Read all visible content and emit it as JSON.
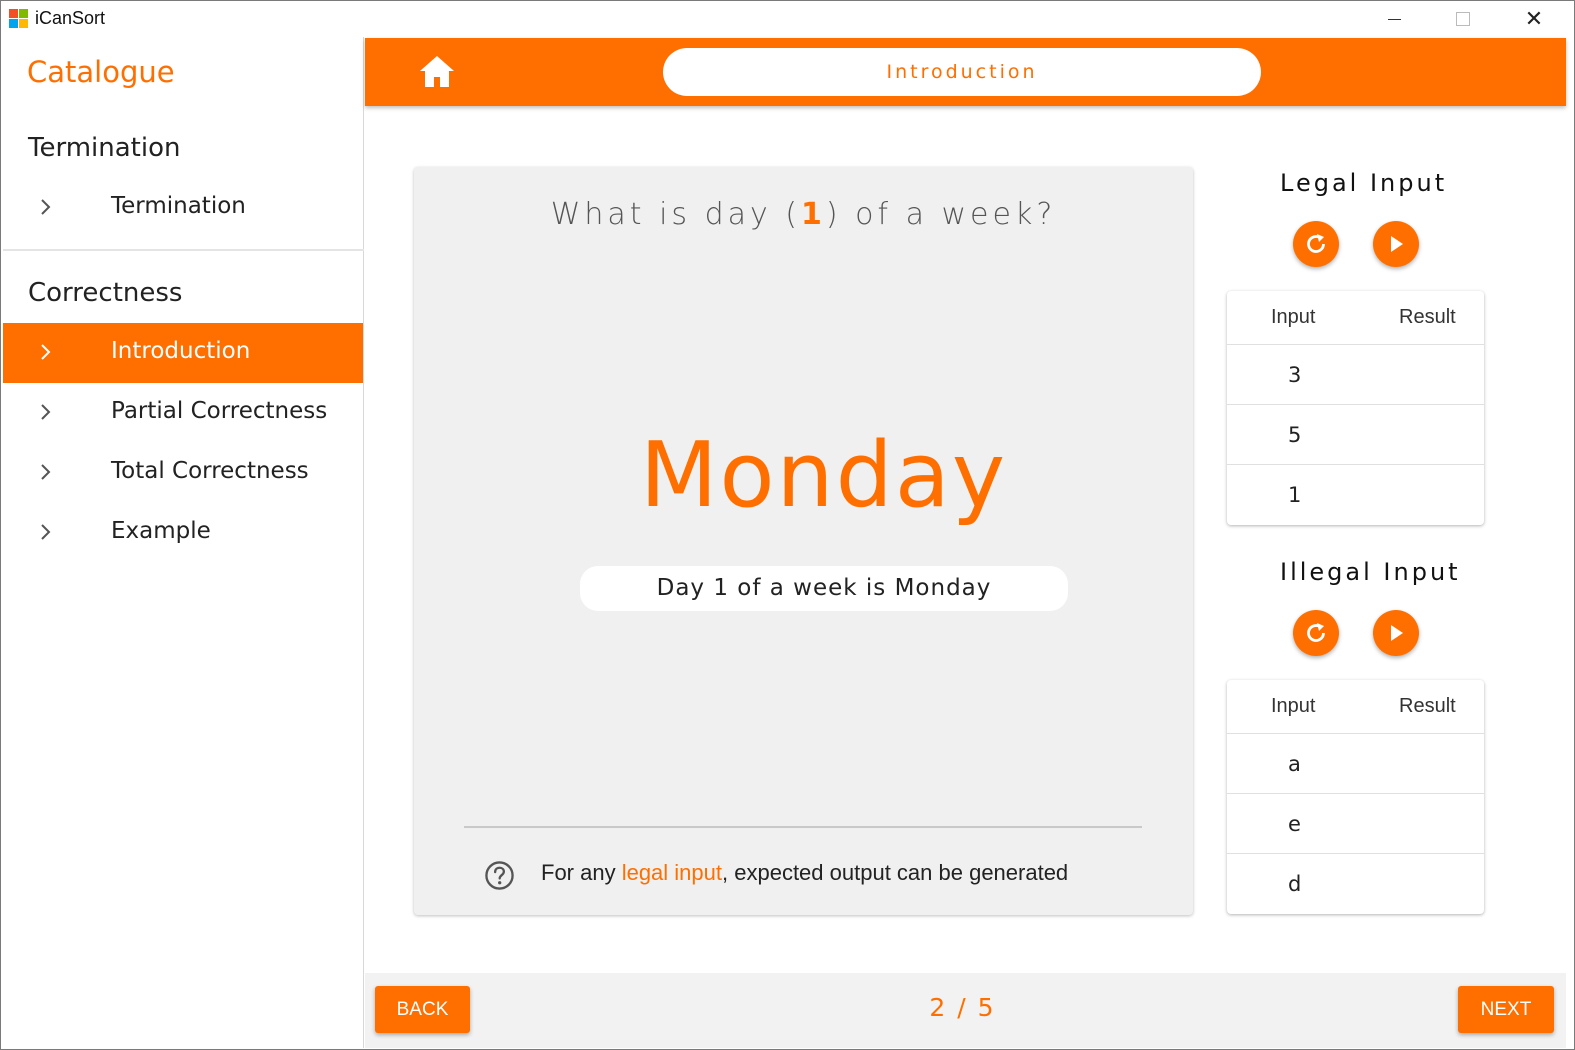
{
  "window": {
    "title": "iCanSort",
    "icon": "app-logo-icon",
    "controls": [
      "minimize-icon",
      "maximize-icon",
      "close-icon"
    ],
    "close_glyph": "✕"
  },
  "colors": {
    "accent": "#ff6f00",
    "card_bg": "#f0f0f0",
    "bottom_bar_bg": "#f2f2f2"
  },
  "sidebar": {
    "title": "Catalogue",
    "sections": [
      {
        "title": "Termination",
        "items": [
          {
            "label": "Termination",
            "active": false
          }
        ]
      },
      {
        "title": "Correctness",
        "items": [
          {
            "label": "Introduction",
            "active": true
          },
          {
            "label": "Partial Correctness",
            "active": false
          },
          {
            "label": "Total Correctness",
            "active": false
          },
          {
            "label": "Example",
            "active": false
          }
        ]
      }
    ]
  },
  "header": {
    "home_icon": "home-icon",
    "title": "Introduction"
  },
  "card": {
    "question_pre": "What is day (",
    "question_num": "1",
    "question_post": ") of a week?",
    "big_answer": "Monday",
    "answer_sentence": "Day 1 of a week is Monday",
    "hint_icon": "help-circle-icon",
    "hint_pre": "For any ",
    "hint_accent": "legal input",
    "hint_post": ", expected output can be generated"
  },
  "legal_panel": {
    "title": "Legal Input",
    "buttons": [
      "refresh-icon",
      "play-icon"
    ],
    "columns": [
      "Input",
      "Result"
    ],
    "rows": [
      {
        "input": "3",
        "result": ""
      },
      {
        "input": "5",
        "result": ""
      },
      {
        "input": "1",
        "result": ""
      }
    ]
  },
  "illegal_panel": {
    "title": "Illegal Input",
    "buttons": [
      "refresh-icon",
      "play-icon"
    ],
    "columns": [
      "Input",
      "Result"
    ],
    "rows": [
      {
        "input": "a",
        "result": ""
      },
      {
        "input": "e",
        "result": ""
      },
      {
        "input": "d",
        "result": ""
      }
    ]
  },
  "footer": {
    "back_label": "BACK",
    "next_label": "NEXT",
    "page_indicator": "2 / 5"
  }
}
